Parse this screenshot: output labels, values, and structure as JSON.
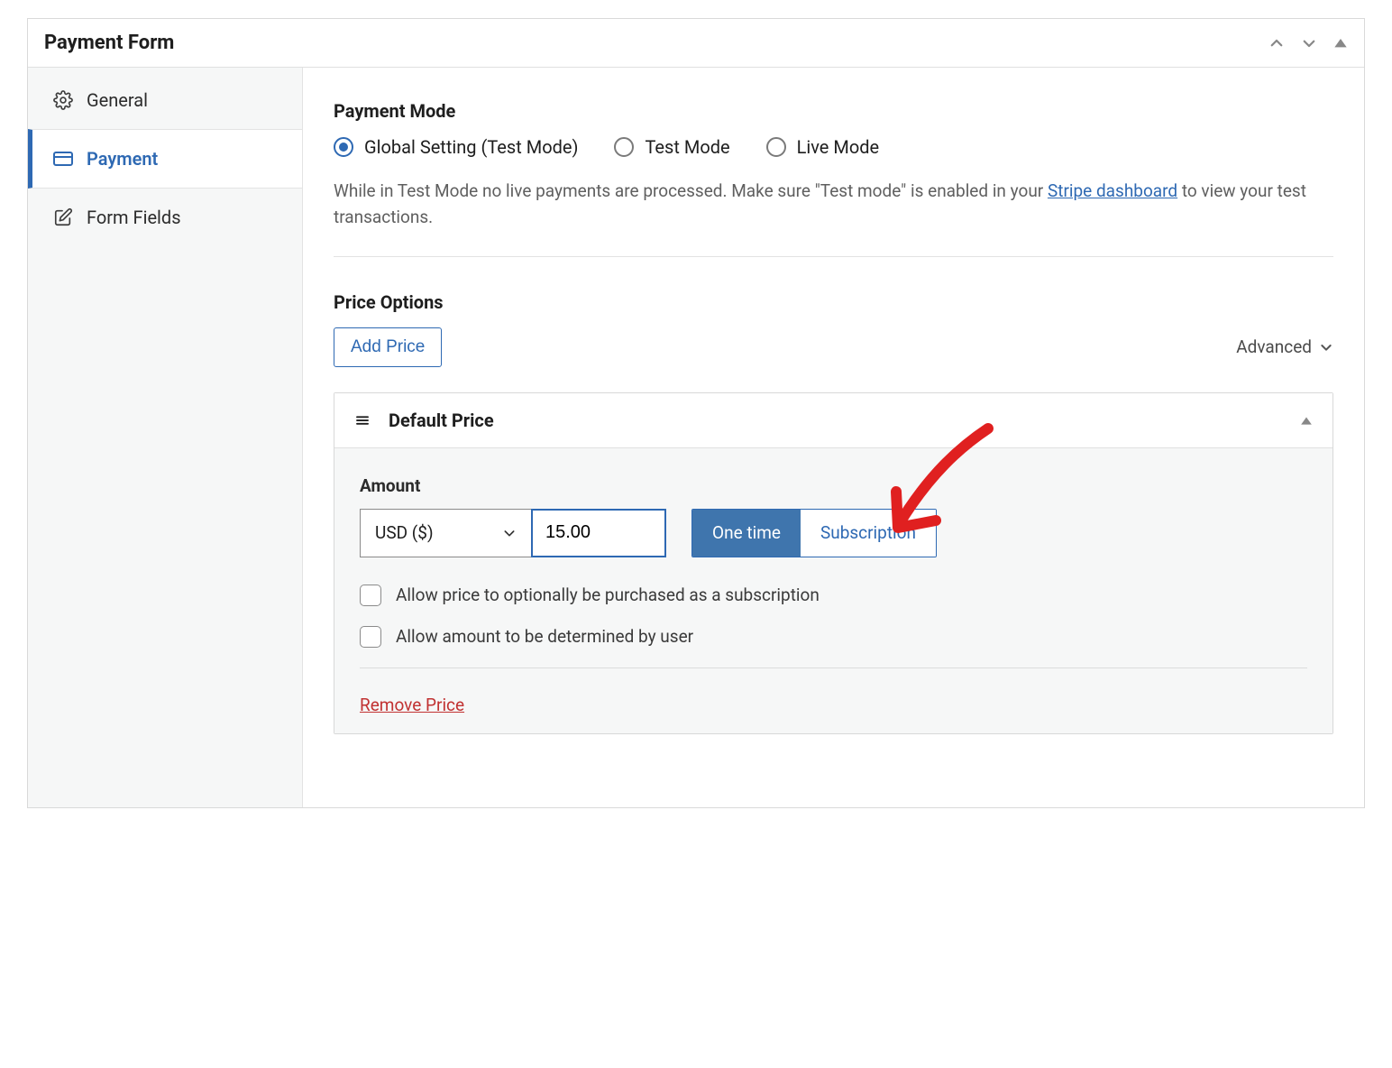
{
  "panel": {
    "title": "Payment Form"
  },
  "tabs": {
    "general": "General",
    "payment": "Payment",
    "form_fields": "Form Fields"
  },
  "payment_mode": {
    "heading": "Payment Mode",
    "options": {
      "global": "Global Setting (Test Mode)",
      "test": "Test Mode",
      "live": "Live Mode"
    },
    "hint_pre": "While in Test Mode no live payments are processed. Make sure \"Test mode\" is enabled in your ",
    "hint_link": "Stripe dashboard",
    "hint_post": " to view your test transactions."
  },
  "price_options": {
    "heading": "Price Options",
    "add_button": "Add Price",
    "advanced": "Advanced"
  },
  "default_price": {
    "title": "Default Price",
    "amount_label": "Amount",
    "currency": "USD ($)",
    "amount_value": "15.00",
    "one_time": "One time",
    "subscription": "Subscription",
    "allow_sub": "Allow price to optionally be purchased as a subscription",
    "allow_user_amount": "Allow amount to be determined by user",
    "remove": "Remove Price"
  }
}
